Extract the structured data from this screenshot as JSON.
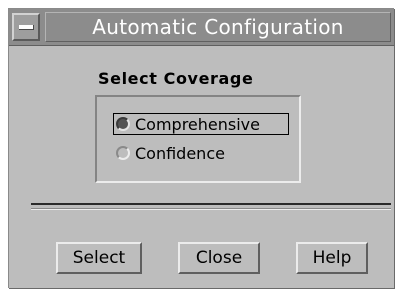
{
  "window": {
    "title": "Automatic Configuration"
  },
  "heading": "Select Coverage",
  "coverage_options": [
    {
      "label": "Comprehensive",
      "selected": true
    },
    {
      "label": "Confidence",
      "selected": false
    }
  ],
  "buttons": {
    "select": "Select",
    "close": "Close",
    "help": "Help"
  },
  "colors": {
    "window_bg": "#bdbdbd",
    "titlebar_bg": "#8c8c8c",
    "title_text": "#ffffff"
  },
  "icons": {
    "window_menu": "window-menu-icon"
  }
}
